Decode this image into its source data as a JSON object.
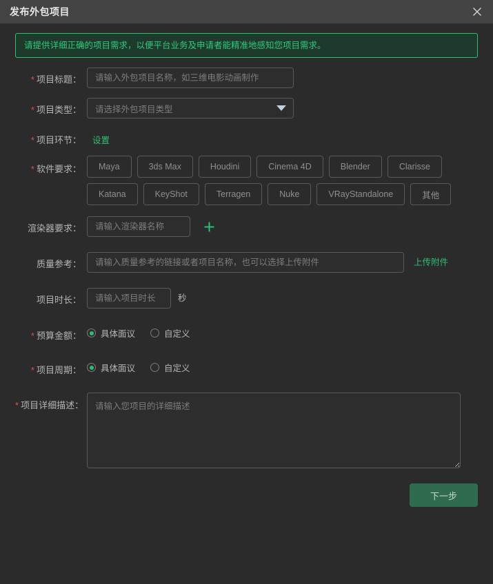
{
  "window": {
    "title": "发布外包项目",
    "close_icon": "close-icon"
  },
  "notice": {
    "text": "请提供详细正确的项目需求，以便平台业务及申请者能精准地感知您项目需求。"
  },
  "form": {
    "required_mark": "*",
    "project_title": {
      "label": "项目标题：",
      "placeholder": "请输入外包项目名称，如三维电影动画制作",
      "value": ""
    },
    "project_type": {
      "label": "项目类型：",
      "placeholder": "请选择外包项目类型",
      "value": "",
      "caret_icon": "chevron-down-icon"
    },
    "project_stage": {
      "label": "项目环节：",
      "link_label": "设置"
    },
    "software": {
      "label": "软件要求：",
      "options": [
        "Maya",
        "3ds Max",
        "Houdini",
        "Cinema 4D",
        "Blender",
        "Clarisse",
        "Katana",
        "KeyShot",
        "Terragen",
        "Nuke",
        "VRayStandalone",
        "其他"
      ]
    },
    "renderer": {
      "label": "渲染器要求：",
      "placeholder": "请输入渲染器名称",
      "value": "",
      "add_icon": "plus-icon"
    },
    "quality_reference": {
      "label": "质量参考：",
      "placeholder": "请输入质量参考的链接或者项目名称，也可以选择上传附件",
      "value": "",
      "upload_label": "上传附件"
    },
    "duration": {
      "label": "项目时长：",
      "placeholder": "请输入项目时长",
      "value": "",
      "unit": "秒"
    },
    "budget": {
      "label": "预算金额：",
      "options": [
        "具体面议",
        "自定义"
      ],
      "selected": "具体面议"
    },
    "period": {
      "label": "项目周期：",
      "options": [
        "具体面议",
        "自定义"
      ],
      "selected": "具体面议"
    },
    "description": {
      "label": "项目详细描述：",
      "placeholder": "请输入您项目的详细描述",
      "value": ""
    }
  },
  "footer": {
    "next_label": "下一步"
  },
  "colors": {
    "accent_green": "#2fbf71",
    "required_red": "#e4504d",
    "titlebar_bg": "#434343",
    "body_bg": "#2b2b2b",
    "button_green": "#2e6b4f"
  }
}
